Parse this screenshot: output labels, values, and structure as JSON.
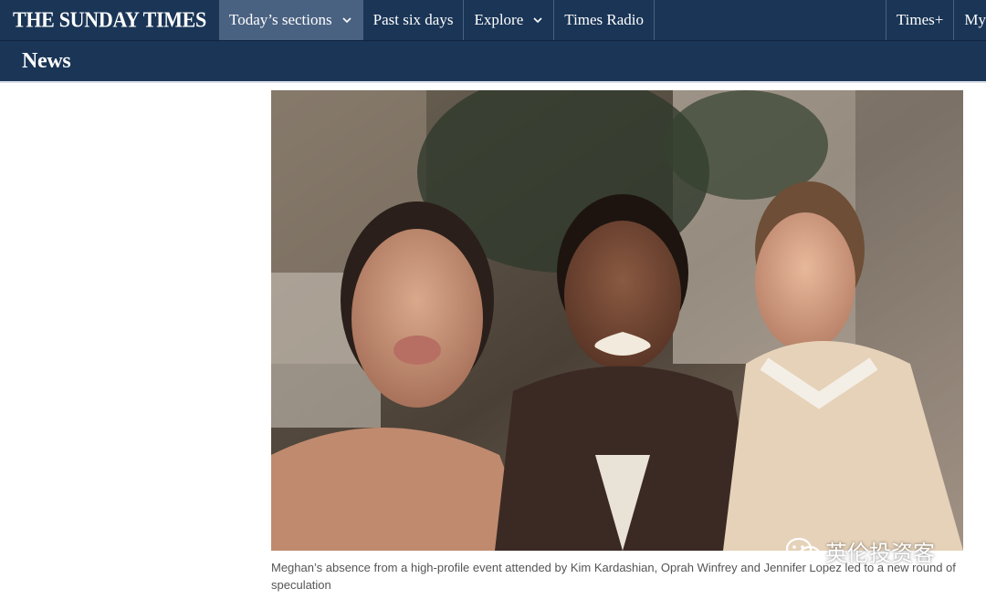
{
  "header": {
    "brand": "THE SUNDAY TIMES",
    "nav": [
      {
        "label": "Today’s sections",
        "has_dropdown": true,
        "active": true
      },
      {
        "label": "Past six days",
        "has_dropdown": false,
        "active": false
      },
      {
        "label": "Explore",
        "has_dropdown": true,
        "active": false
      },
      {
        "label": "Times Radio",
        "has_dropdown": false,
        "active": false
      }
    ],
    "right_nav": [
      {
        "label": "Times+"
      },
      {
        "label": "My"
      }
    ],
    "colors": {
      "bar": "#1a3556",
      "active_tab": "#4a6282"
    }
  },
  "section": {
    "title": "News"
  },
  "article": {
    "image_icon": "photo-image",
    "caption": "Meghan’s absence from a high-profile event attended by Kim Kardashian, Oprah Winfrey and Jennifer Lopez led to a new round of speculation"
  },
  "watermark": {
    "icon": "wechat-icon",
    "text": "英伦投资客"
  }
}
